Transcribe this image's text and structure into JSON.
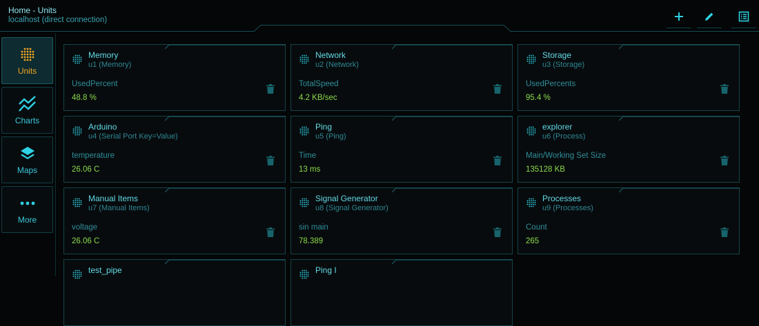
{
  "header": {
    "title": "Home - Units",
    "subtitle": "localhost (direct connection)",
    "actions": [
      {
        "name": "add-button",
        "icon": "plus-icon"
      },
      {
        "name": "edit-button",
        "icon": "pencil-icon"
      },
      {
        "name": "list-view-button",
        "icon": "list-icon"
      }
    ]
  },
  "sidebar": {
    "items": [
      {
        "label": "Units",
        "icon": "units-icon",
        "active": true
      },
      {
        "label": "Charts",
        "icon": "chart-line-icon",
        "active": false
      },
      {
        "label": "Maps",
        "icon": "layers-icon",
        "active": false
      },
      {
        "label": "More",
        "icon": "more-dots-icon",
        "active": false
      }
    ]
  },
  "colors": {
    "accent": "#2fd1e4",
    "active_nav": "#f5a623",
    "value_green": "#8bd94a",
    "card_border": "#16434a"
  },
  "units": [
    {
      "name": "Memory",
      "sub": "u1 (Memory)",
      "label": "UsedPercent",
      "value": "48.8 %"
    },
    {
      "name": "Network",
      "sub": "u2 (Network)",
      "label": "TotalSpeed",
      "value": "4.2 KB/sec"
    },
    {
      "name": "Storage",
      "sub": "u3 (Storage)",
      "label": "UsedPercents",
      "value": "95.4 %"
    },
    {
      "name": "Arduino",
      "sub": "u4 (Serial Port Key=Value)",
      "label": "temperature",
      "value": "26.06 C"
    },
    {
      "name": "Ping",
      "sub": "u5 (Ping)",
      "label": "Time",
      "value": "13 ms"
    },
    {
      "name": "explorer",
      "sub": "u6 (Process)",
      "label": "Main/Working Set Size",
      "value": "135128 KB"
    },
    {
      "name": "Manual Items",
      "sub": "u7 (Manual Items)",
      "label": "voltage",
      "value": "26.06 C"
    },
    {
      "name": "Signal Generator",
      "sub": "u8 (Signal Generator)",
      "label": "sin main",
      "value": "78.389"
    },
    {
      "name": "Processes",
      "sub": "u9 (Processes)",
      "label": "Count",
      "value": "265"
    },
    {
      "name": "test_pipe",
      "sub": "",
      "label": "",
      "value": ""
    },
    {
      "name": "Ping I",
      "sub": "",
      "label": "",
      "value": ""
    }
  ]
}
